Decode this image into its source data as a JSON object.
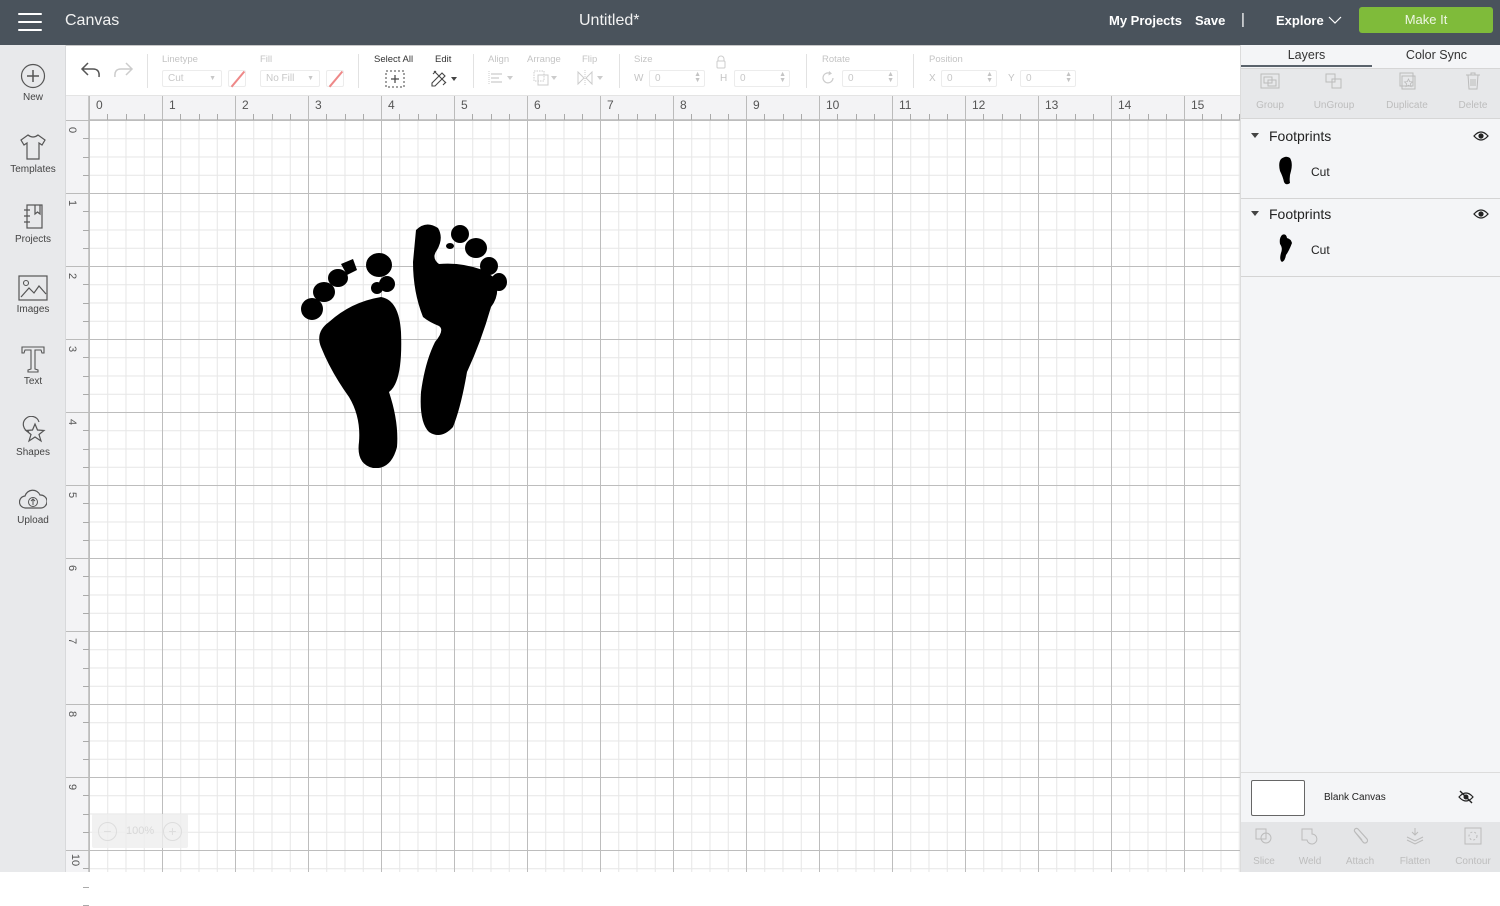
{
  "topbar": {
    "app_title": "Canvas",
    "document_title": "Untitled*",
    "my_projects": "My Projects",
    "save": "Save",
    "separator": "|",
    "explore": "Explore",
    "make_it": "Make It",
    "make_it_color": "#7fbb3a",
    "bar_color": "#4a535c"
  },
  "sidebar": {
    "items": [
      {
        "label": "New",
        "icon": "plus-circle-icon"
      },
      {
        "label": "Templates",
        "icon": "tshirt-icon"
      },
      {
        "label": "Projects",
        "icon": "notebook-icon"
      },
      {
        "label": "Images",
        "icon": "image-icon"
      },
      {
        "label": "Text",
        "icon": "text-t-icon"
      },
      {
        "label": "Shapes",
        "icon": "shapes-icon"
      },
      {
        "label": "Upload",
        "icon": "cloud-upload-icon"
      }
    ]
  },
  "toolbar": {
    "linetype_label": "Linetype",
    "linetype_value": "Cut",
    "fill_label": "Fill",
    "fill_value": "No Fill",
    "select_all_label": "Select All",
    "edit_label": "Edit",
    "align_label": "Align",
    "arrange_label": "Arrange",
    "flip_label": "Flip",
    "size_label": "Size",
    "w_label": "W",
    "w_value": "0",
    "h_label": "H",
    "h_value": "0",
    "rotate_label": "Rotate",
    "rotate_value": "0",
    "position_label": "Position",
    "x_label": "X",
    "x_value": "0",
    "y_label": "Y",
    "y_value": "0"
  },
  "rulers": {
    "horizontal": [
      "0",
      "1",
      "2",
      "3",
      "4",
      "5",
      "6",
      "7",
      "8",
      "9",
      "10",
      "11",
      "12",
      "13",
      "14",
      "15"
    ],
    "vertical": [
      "0",
      "1",
      "2",
      "3",
      "4",
      "5",
      "6",
      "7",
      "8",
      "9",
      "10"
    ],
    "unit": "in"
  },
  "zoom": {
    "value": "100%",
    "minus": "−",
    "plus": "+"
  },
  "panel": {
    "tabs": [
      {
        "label": "Layers",
        "active": true
      },
      {
        "label": "Color Sync",
        "active": false
      }
    ],
    "tools": [
      {
        "label": "Group",
        "icon": "group-icon"
      },
      {
        "label": "UnGroup",
        "icon": "ungroup-icon"
      },
      {
        "label": "Duplicate",
        "icon": "duplicate-icon"
      },
      {
        "label": "Delete",
        "icon": "trash-icon"
      }
    ],
    "layers": [
      {
        "name": "Footprints",
        "child_label": "Cut",
        "visible": true
      },
      {
        "name": "Footprints",
        "child_label": "Cut",
        "visible": true
      }
    ],
    "blank_canvas": {
      "label": "Blank Canvas",
      "visible": false
    },
    "bottom_tools": [
      {
        "label": "Slice",
        "icon": "slice-icon"
      },
      {
        "label": "Weld",
        "icon": "weld-icon"
      },
      {
        "label": "Attach",
        "icon": "paperclip-icon"
      },
      {
        "label": "Flatten",
        "icon": "flatten-icon"
      },
      {
        "label": "Contour",
        "icon": "contour-icon"
      }
    ]
  }
}
